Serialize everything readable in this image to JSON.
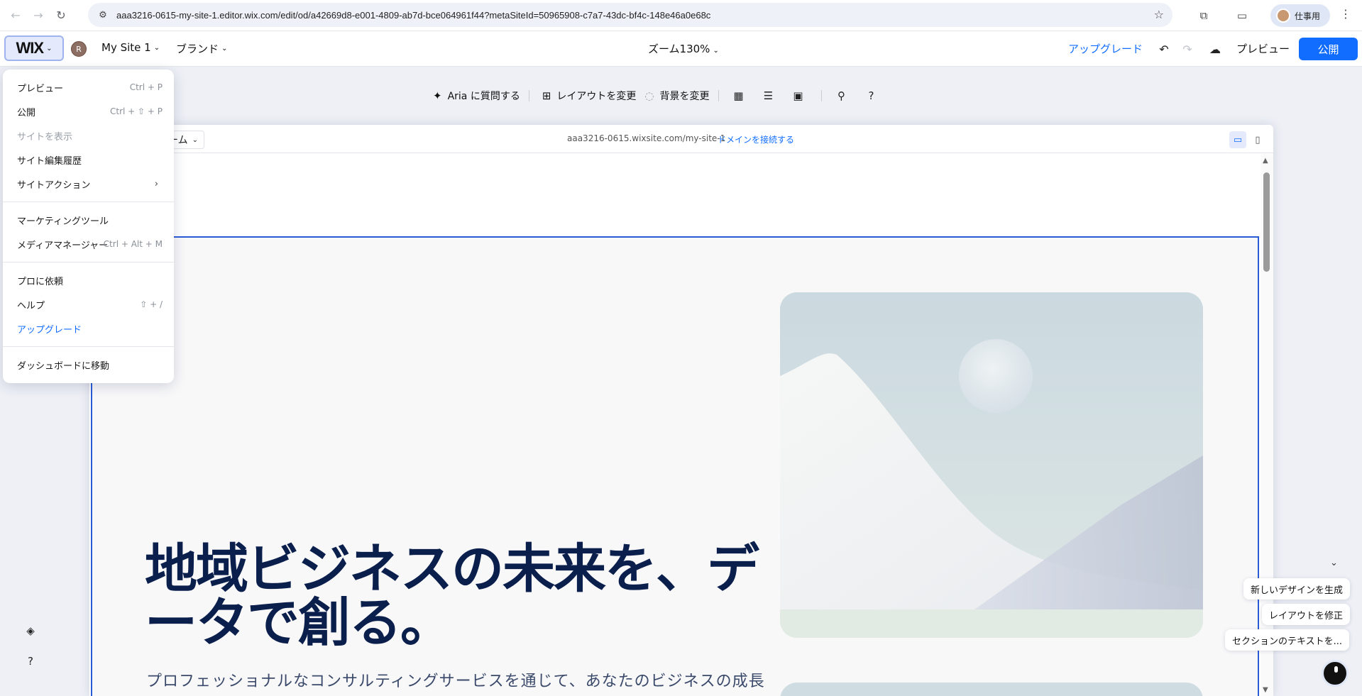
{
  "browser": {
    "url": "aaa3216-0615-my-site-1.editor.wix.com/edit/od/a42669d8-e001-4809-ab7d-bce064961f44?metaSiteId=50965908-c7a7-43dc-bf4c-148e46a0e68c",
    "profile_label": "仕事用"
  },
  "topbar": {
    "logo": "WIX",
    "avatar_letter": "R",
    "site_name": "My Site 1",
    "brand_menu": "ブランド",
    "zoom": "ズーム130%",
    "upgrade": "アップグレード",
    "preview": "プレビュー",
    "publish": "公開"
  },
  "toolbar": {
    "ask_aria": "Aria に質問する",
    "change_layout": "レイアウトを変更",
    "change_background": "背景を変更",
    "help": "?"
  },
  "canvas": {
    "page_select": "ジ：ホーム",
    "site_url": "aaa3216-0615.wixsite.com/my-site-1",
    "connect_domain": "ドメインを接続する",
    "hero_title": "地域ビジネスの未来を、データで創る。",
    "hero_subtitle": "プロフェッショナルなコンサルティングサービスを通じて、あなたのビジネスの成長"
  },
  "menu": {
    "items": [
      {
        "label": "プレビュー",
        "shortcut": "Ctrl + P"
      },
      {
        "label": "公開",
        "shortcut": "Ctrl + ⇧ + P"
      },
      {
        "label": "サイトを表示",
        "shortcut": ""
      },
      {
        "label": "サイト編集履歴",
        "shortcut": ""
      },
      {
        "label": "サイトアクション",
        "shortcut": ""
      },
      {
        "label": "マーケティングツール",
        "shortcut": ""
      },
      {
        "label": "メディアマネージャー",
        "shortcut": "Ctrl + Alt + M"
      },
      {
        "label": "プロに依頼",
        "shortcut": ""
      },
      {
        "label": "ヘルプ",
        "shortcut": "⇧ + /"
      },
      {
        "label": "アップグレード",
        "shortcut": ""
      },
      {
        "label": "ダッシュボードに移動",
        "shortcut": ""
      }
    ]
  },
  "ai_suggestions": {
    "generate_design": "新しいデザインを生成",
    "fix_layout": "レイアウトを修正",
    "section_text": "セクションのテキストを..."
  },
  "colors": {
    "accent": "#116dff",
    "title": "#0b1f4d",
    "selection": "#2a5bd7"
  }
}
